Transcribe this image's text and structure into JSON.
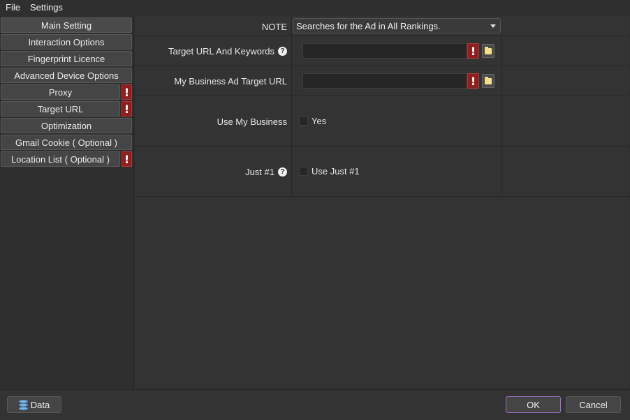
{
  "menu": {
    "file": "File",
    "settings": "Settings"
  },
  "sidebar": {
    "items": [
      {
        "label": "Main Setting",
        "alert": false
      },
      {
        "label": "Interaction Options",
        "alert": false
      },
      {
        "label": "Fingerprint Licence",
        "alert": false
      },
      {
        "label": "Advanced Device Options",
        "alert": false
      },
      {
        "label": "Proxy",
        "alert": true
      },
      {
        "label": "Target URL",
        "alert": true
      },
      {
        "label": "Optimization",
        "alert": false
      },
      {
        "label": "Gmail Cookie ( Optional )",
        "alert": false
      },
      {
        "label": "Location List ( Optional )",
        "alert": true
      }
    ],
    "alert_glyph": "!"
  },
  "form": {
    "note_label": "NOTE",
    "note_value": "Searches for the Ad in All Rankings.",
    "target_url_label": "Target URL And Keywords",
    "target_url_value": "",
    "my_business_url_label": "My Business Ad Target URL",
    "my_business_url_value": "",
    "use_my_business_label": "Use My Business",
    "use_my_business_option": "Yes",
    "just1_label": "Just #1",
    "just1_option": "Use Just #1",
    "help_glyph": "?"
  },
  "footer": {
    "data_label": "Data",
    "ok_label": "OK",
    "cancel_label": "Cancel"
  },
  "colors": {
    "background": "#2f2f2f",
    "alert": "#8e1f1f",
    "ok_border": "#a070c8",
    "folder": "#f3e08a"
  }
}
